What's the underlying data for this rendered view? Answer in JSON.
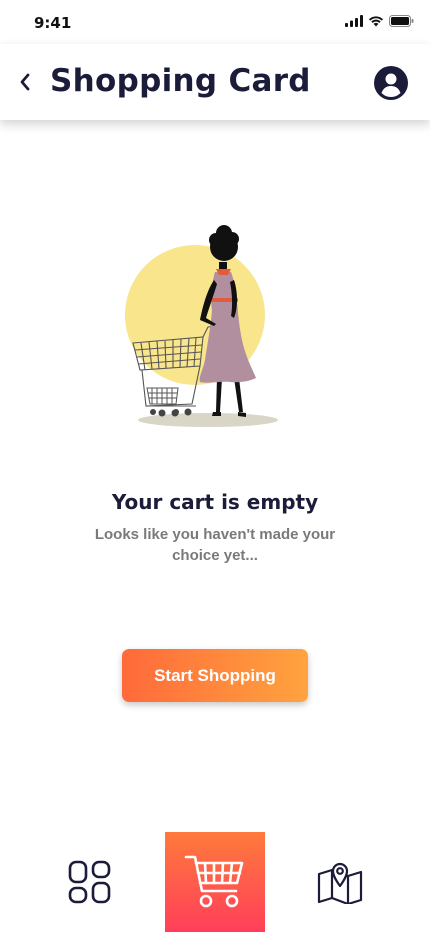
{
  "status_bar": {
    "time": "9:41",
    "icons": [
      "signal-icon",
      "wifi-icon",
      "battery-icon"
    ]
  },
  "header": {
    "title": "Shopping Card",
    "back_icon": "chevron-left-icon",
    "profile_icon": "user-circle-icon"
  },
  "empty_state": {
    "illustration": "woman-with-shopping-cart",
    "title": "Your cart is empty",
    "subtitle": "Looks like you haven't made your choice yet..."
  },
  "actions": {
    "start_label": "Start Shopping"
  },
  "bottom_nav": {
    "items": [
      {
        "icon": "grid-icon",
        "active": false
      },
      {
        "icon": "cart-icon",
        "active": true
      },
      {
        "icon": "map-pin-icon",
        "active": false
      }
    ]
  },
  "colors": {
    "primary_text": "#1b1b3a",
    "muted_text": "#7a7a7a",
    "accent_start": "#ff6a3a",
    "accent_end": "#ffa33f",
    "nav_active_top": "#ff7a3c",
    "nav_active_bottom": "#ff3f5a",
    "illustration_circle": "#f8e58c"
  }
}
